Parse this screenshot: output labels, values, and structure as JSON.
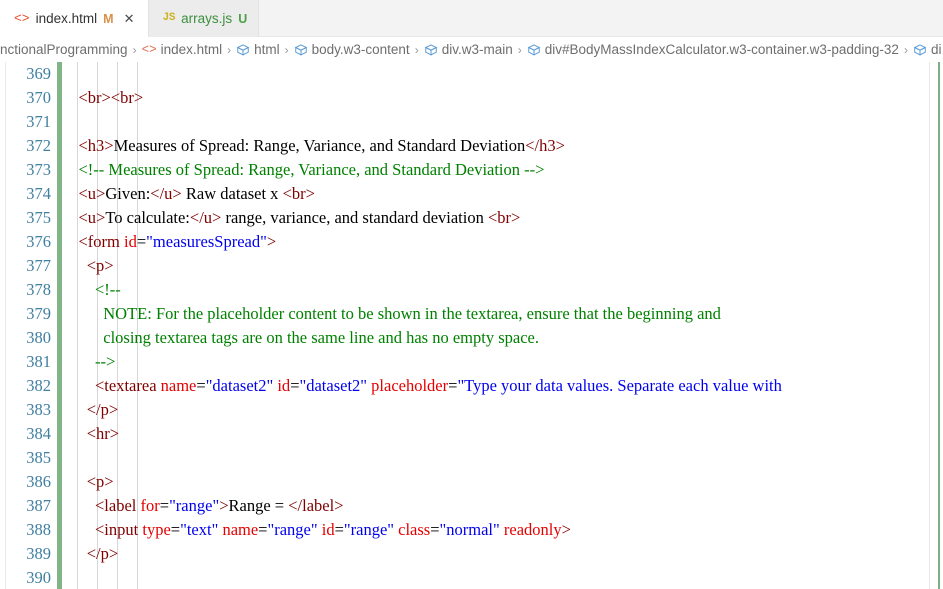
{
  "window": {
    "app": "code-editor",
    "colors": {
      "tagColor": "#800000",
      "attrColor": "#e50000",
      "valueColor": "#0000ee",
      "commentColor": "#008000",
      "lineNumberColor": "#3f7fa0",
      "gitModifiedGreen": "#81b588",
      "activeTabBackground": "#ffffff",
      "inactiveTabBackground": "#ececec"
    }
  },
  "tabs": [
    {
      "icon": "html5-icon",
      "icon_text": "<>",
      "label": "index.html",
      "badge": "M",
      "badge_name": "modified-badge",
      "close": "✕",
      "active": true
    },
    {
      "icon": "javascript-icon",
      "icon_text": "JS",
      "label": "arrays.js",
      "badge": "U",
      "badge_name": "untracked-badge",
      "close": "",
      "active": false
    }
  ],
  "breadcrumb": {
    "separator": "›",
    "items": [
      {
        "icon": "none",
        "label": "nctionalProgramming"
      },
      {
        "icon": "html-file-icon",
        "label": "index.html"
      },
      {
        "icon": "symbol-cube-icon",
        "label": "html"
      },
      {
        "icon": "symbol-cube-icon",
        "label": "body.w3-content"
      },
      {
        "icon": "symbol-cube-icon",
        "label": "div.w3-main"
      },
      {
        "icon": "symbol-cube-icon",
        "label": "div#BodyMassIndexCalculator.w3-container.w3-padding-32"
      },
      {
        "icon": "symbol-cube-icon",
        "label": "di"
      }
    ]
  },
  "editor": {
    "first_line": 369,
    "last_line": 390,
    "line_numbers": [
      369,
      370,
      371,
      372,
      373,
      374,
      375,
      376,
      377,
      378,
      379,
      380,
      381,
      382,
      383,
      384,
      385,
      386,
      387,
      388,
      389,
      390
    ],
    "lines": [
      {
        "n": 369,
        "tokens": []
      },
      {
        "n": 370,
        "tokens": [
          {
            "c": "tag",
            "t": "    <br><br>"
          }
        ]
      },
      {
        "n": 371,
        "tokens": []
      },
      {
        "n": 372,
        "tokens": [
          {
            "c": "tag",
            "t": "    <h3>"
          },
          {
            "c": "txt",
            "t": "Measures of Spread: Range, Variance, and Standard Deviation"
          },
          {
            "c": "tag",
            "t": "</h3>"
          }
        ]
      },
      {
        "n": 373,
        "tokens": [
          {
            "c": "com",
            "t": "    <!-- Measures of Spread: Range, Variance, and Standard Deviation -->"
          }
        ]
      },
      {
        "n": 374,
        "tokens": [
          {
            "c": "tag",
            "t": "    <u>"
          },
          {
            "c": "txt",
            "t": "Given:"
          },
          {
            "c": "tag",
            "t": "</u>"
          },
          {
            "c": "txt",
            "t": " Raw dataset x "
          },
          {
            "c": "tag",
            "t": "<br>"
          }
        ]
      },
      {
        "n": 375,
        "tokens": [
          {
            "c": "tag",
            "t": "    <u>"
          },
          {
            "c": "txt",
            "t": "To calculate:"
          },
          {
            "c": "tag",
            "t": "</u>"
          },
          {
            "c": "txt",
            "t": " range, variance, and standard deviation "
          },
          {
            "c": "tag",
            "t": "<br>"
          }
        ]
      },
      {
        "n": 376,
        "tokens": [
          {
            "c": "tag",
            "t": "    <form "
          },
          {
            "c": "attr",
            "t": "id"
          },
          {
            "c": "punc",
            "t": "="
          },
          {
            "c": "val",
            "t": "\"measuresSpread\""
          },
          {
            "c": "tag",
            "t": ">"
          }
        ]
      },
      {
        "n": 377,
        "tokens": [
          {
            "c": "tag",
            "t": "      <p>"
          }
        ]
      },
      {
        "n": 378,
        "tokens": [
          {
            "c": "com",
            "t": "        <!--"
          }
        ]
      },
      {
        "n": 379,
        "tokens": [
          {
            "c": "com",
            "t": "          NOTE: For the placeholder content to be shown in the textarea, ensure that the beginning and"
          }
        ]
      },
      {
        "n": 380,
        "tokens": [
          {
            "c": "com",
            "t": "          closing textarea tags are on the same line and has no empty space."
          }
        ]
      },
      {
        "n": 381,
        "tokens": [
          {
            "c": "com",
            "t": "        -->"
          }
        ]
      },
      {
        "n": 382,
        "tokens": [
          {
            "c": "tag",
            "t": "        <textarea "
          },
          {
            "c": "attr",
            "t": "name"
          },
          {
            "c": "punc",
            "t": "="
          },
          {
            "c": "val",
            "t": "\"dataset2\""
          },
          {
            "c": "punc",
            "t": " "
          },
          {
            "c": "attr",
            "t": "id"
          },
          {
            "c": "punc",
            "t": "="
          },
          {
            "c": "val",
            "t": "\"dataset2\""
          },
          {
            "c": "punc",
            "t": " "
          },
          {
            "c": "attr",
            "t": "placeholder"
          },
          {
            "c": "punc",
            "t": "="
          },
          {
            "c": "val",
            "t": "\"Type your data values. Separate each value with"
          }
        ]
      },
      {
        "n": 383,
        "tokens": [
          {
            "c": "tag",
            "t": "      </p>"
          }
        ]
      },
      {
        "n": 384,
        "tokens": [
          {
            "c": "tag",
            "t": "      <hr>"
          }
        ]
      },
      {
        "n": 385,
        "tokens": []
      },
      {
        "n": 386,
        "tokens": [
          {
            "c": "tag",
            "t": "      <p>"
          }
        ]
      },
      {
        "n": 387,
        "tokens": [
          {
            "c": "tag",
            "t": "        <label "
          },
          {
            "c": "attr",
            "t": "for"
          },
          {
            "c": "punc",
            "t": "="
          },
          {
            "c": "val",
            "t": "\"range\""
          },
          {
            "c": "tag",
            "t": ">"
          },
          {
            "c": "txt",
            "t": "Range = "
          },
          {
            "c": "tag",
            "t": "</label>"
          }
        ]
      },
      {
        "n": 388,
        "tokens": [
          {
            "c": "tag",
            "t": "        <input "
          },
          {
            "c": "attr",
            "t": "type"
          },
          {
            "c": "punc",
            "t": "="
          },
          {
            "c": "val",
            "t": "\"text\""
          },
          {
            "c": "punc",
            "t": " "
          },
          {
            "c": "attr",
            "t": "name"
          },
          {
            "c": "punc",
            "t": "="
          },
          {
            "c": "val",
            "t": "\"range\""
          },
          {
            "c": "punc",
            "t": " "
          },
          {
            "c": "attr",
            "t": "id"
          },
          {
            "c": "punc",
            "t": "="
          },
          {
            "c": "val",
            "t": "\"range\""
          },
          {
            "c": "punc",
            "t": " "
          },
          {
            "c": "attr",
            "t": "class"
          },
          {
            "c": "punc",
            "t": "="
          },
          {
            "c": "val",
            "t": "\"normal\""
          },
          {
            "c": "punc",
            "t": " "
          },
          {
            "c": "attr",
            "t": "readonly"
          },
          {
            "c": "tag",
            "t": ">"
          }
        ]
      },
      {
        "n": 389,
        "tokens": [
          {
            "c": "tag",
            "t": "      </p>"
          }
        ]
      },
      {
        "n": 390,
        "tokens": []
      }
    ]
  }
}
